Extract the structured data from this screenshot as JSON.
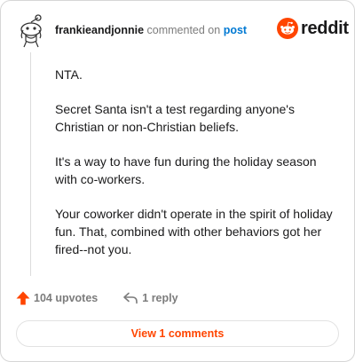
{
  "comment": {
    "username": "frankieandjonnie",
    "action_text": "commented on",
    "post_link": "post",
    "paragraphs": [
      "NTA.",
      "Secret Santa isn't a test regarding anyone's Christian or non-Christian beliefs.",
      "It's a way to have fun during the holiday season with co-workers.",
      "Your coworker didn't operate in the spirit of holiday fun. That, combined with other behaviors got her fired--not you."
    ],
    "upvotes": "104 upvotes",
    "replies": "1 reply",
    "view_button": "View 1 comments"
  },
  "brand": {
    "wordmark": "reddit",
    "color": "#ff4500"
  },
  "icons": {
    "avatar": "snoo-avatar-icon",
    "logo": "reddit-snoo-icon",
    "upvote": "upvote-arrow-icon",
    "reply": "reply-arrow-icon"
  }
}
